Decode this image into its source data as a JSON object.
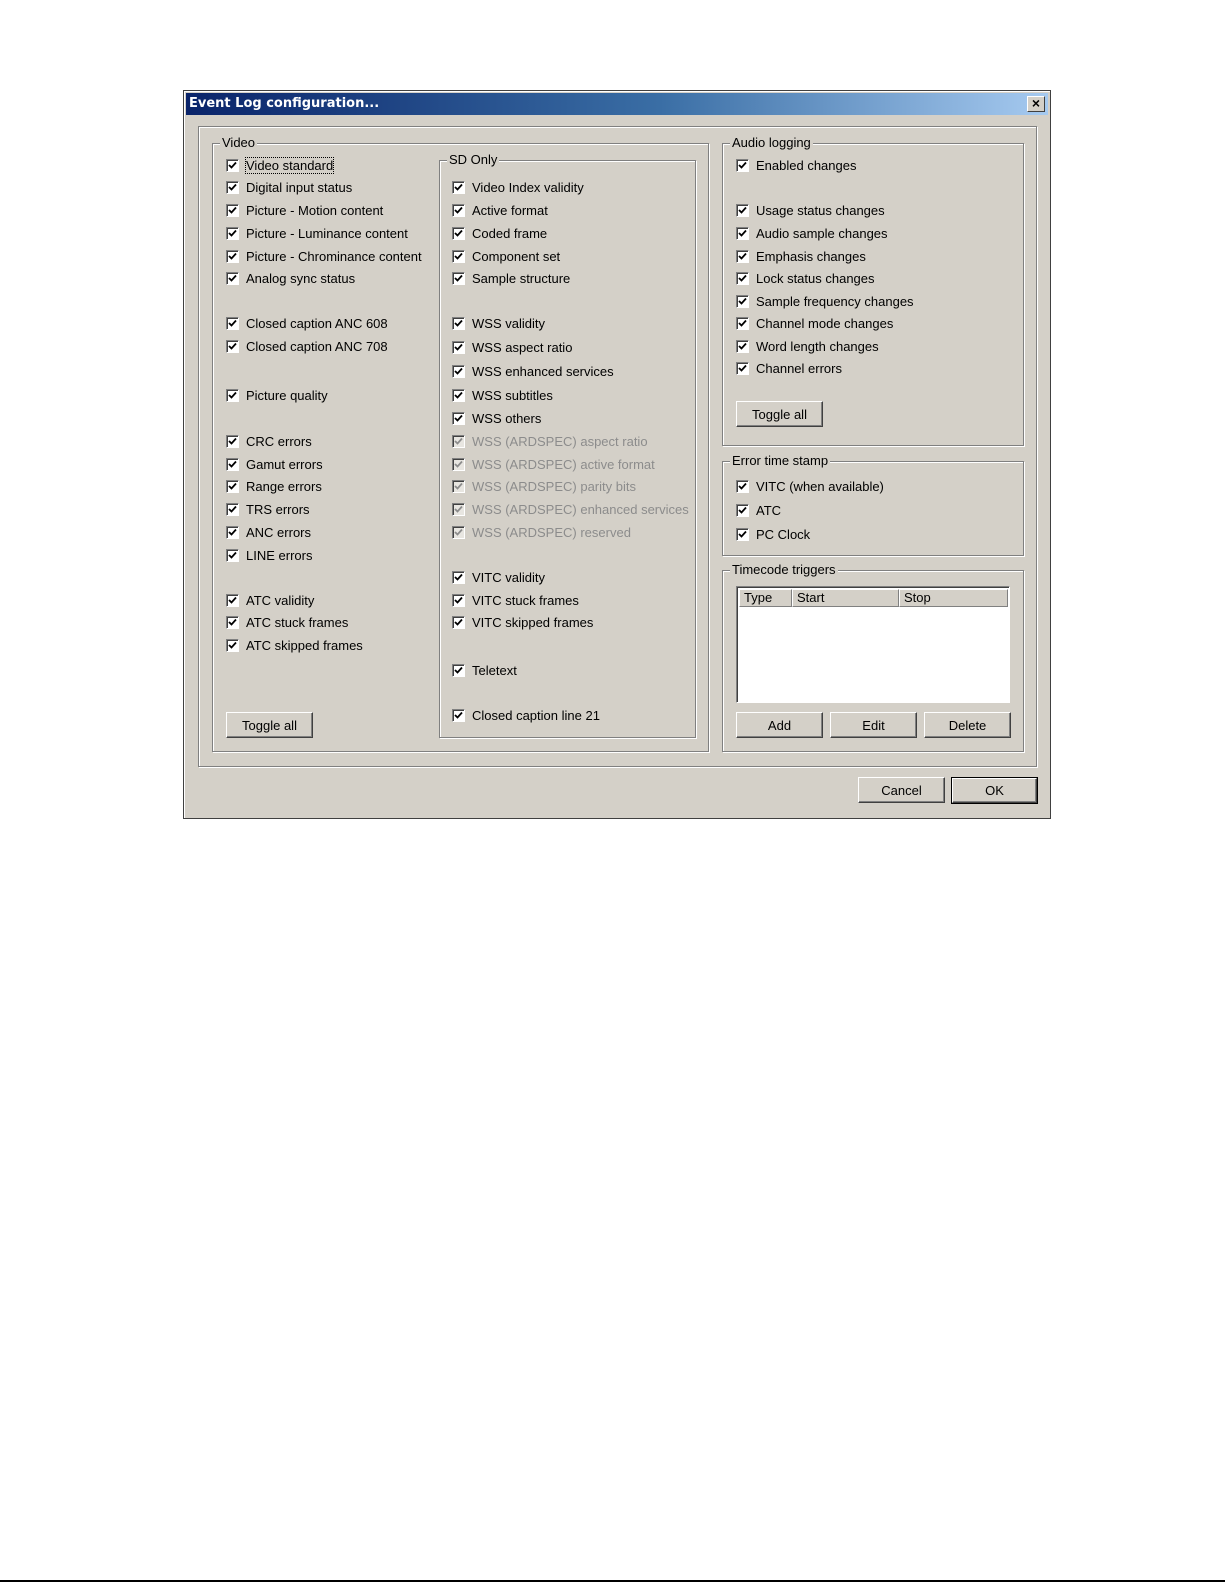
{
  "window": {
    "title": "Event Log configuration...",
    "close_symbol": "×"
  },
  "video": {
    "legend": "Video",
    "items": [
      {
        "label": "Video standard",
        "checked": true,
        "enabled": true
      },
      {
        "label": "Digital input status",
        "checked": true,
        "enabled": true
      },
      {
        "label": "Picture - Motion content",
        "checked": true,
        "enabled": true
      },
      {
        "label": "Picture - Luminance content",
        "checked": true,
        "enabled": true
      },
      {
        "label": "Picture - Chrominance content",
        "checked": true,
        "enabled": true
      },
      {
        "label": "Analog sync status",
        "checked": true,
        "enabled": true
      },
      {
        "label": "Closed caption ANC 608",
        "checked": true,
        "enabled": true
      },
      {
        "label": "Closed caption ANC 708",
        "checked": true,
        "enabled": true
      },
      {
        "label": "Picture quality",
        "checked": true,
        "enabled": true
      },
      {
        "label": "CRC errors",
        "checked": true,
        "enabled": true
      },
      {
        "label": "Gamut errors",
        "checked": true,
        "enabled": true
      },
      {
        "label": "Range errors",
        "checked": true,
        "enabled": true
      },
      {
        "label": "TRS errors",
        "checked": true,
        "enabled": true
      },
      {
        "label": "ANC errors",
        "checked": true,
        "enabled": true
      },
      {
        "label": "LINE errors",
        "checked": true,
        "enabled": true
      },
      {
        "label": "ATC validity",
        "checked": true,
        "enabled": true
      },
      {
        "label": "ATC stuck frames",
        "checked": true,
        "enabled": true
      },
      {
        "label": "ATC skipped frames",
        "checked": true,
        "enabled": true
      }
    ],
    "toggle_all": "Toggle all"
  },
  "sd_only": {
    "legend": "SD Only",
    "items": [
      {
        "label": "Video Index validity",
        "checked": true,
        "enabled": true
      },
      {
        "label": "Active format",
        "checked": true,
        "enabled": true
      },
      {
        "label": "Coded frame",
        "checked": true,
        "enabled": true
      },
      {
        "label": "Component set",
        "checked": true,
        "enabled": true
      },
      {
        "label": "Sample structure",
        "checked": true,
        "enabled": true
      },
      {
        "label": "WSS validity",
        "checked": true,
        "enabled": true
      },
      {
        "label": "WSS aspect ratio",
        "checked": true,
        "enabled": true
      },
      {
        "label": "WSS enhanced services",
        "checked": true,
        "enabled": true
      },
      {
        "label": "WSS subtitles",
        "checked": true,
        "enabled": true
      },
      {
        "label": "WSS others",
        "checked": true,
        "enabled": true
      },
      {
        "label": "WSS (ARDSPEC) aspect ratio",
        "checked": true,
        "enabled": false
      },
      {
        "label": "WSS (ARDSPEC) active format",
        "checked": true,
        "enabled": false
      },
      {
        "label": "WSS (ARDSPEC) parity bits",
        "checked": true,
        "enabled": false
      },
      {
        "label": "WSS (ARDSPEC) enhanced services",
        "checked": true,
        "enabled": false
      },
      {
        "label": "WSS (ARDSPEC) reserved",
        "checked": true,
        "enabled": false
      },
      {
        "label": "VITC validity",
        "checked": true,
        "enabled": true
      },
      {
        "label": "VITC stuck frames",
        "checked": true,
        "enabled": true
      },
      {
        "label": "VITC skipped frames",
        "checked": true,
        "enabled": true
      },
      {
        "label": "Teletext",
        "checked": true,
        "enabled": true
      },
      {
        "label": "Closed caption line 21",
        "checked": true,
        "enabled": true
      }
    ]
  },
  "audio": {
    "legend": "Audio logging",
    "items": [
      {
        "label": "Enabled changes",
        "checked": true,
        "enabled": true
      },
      {
        "label": "Usage status changes",
        "checked": true,
        "enabled": true
      },
      {
        "label": "Audio sample changes",
        "checked": true,
        "enabled": true
      },
      {
        "label": "Emphasis changes",
        "checked": true,
        "enabled": true
      },
      {
        "label": "Lock status changes",
        "checked": true,
        "enabled": true
      },
      {
        "label": "Sample frequency changes",
        "checked": true,
        "enabled": true
      },
      {
        "label": "Channel mode changes",
        "checked": true,
        "enabled": true
      },
      {
        "label": "Word length changes",
        "checked": true,
        "enabled": true
      },
      {
        "label": "Channel errors",
        "checked": true,
        "enabled": true
      }
    ],
    "toggle_all": "Toggle all"
  },
  "timestamp": {
    "legend": "Error time stamp",
    "items": [
      {
        "label": "VITC (when available)",
        "checked": true,
        "enabled": true
      },
      {
        "label": "ATC",
        "checked": true,
        "enabled": true
      },
      {
        "label": "PC Clock",
        "checked": true,
        "enabled": true
      }
    ]
  },
  "timecode": {
    "legend": "Timecode triggers",
    "columns": [
      "Type",
      "Start",
      "Stop"
    ],
    "rows": [],
    "add": "Add",
    "edit": "Edit",
    "delete": "Delete"
  },
  "footer": {
    "cancel": "Cancel",
    "ok": "OK"
  }
}
